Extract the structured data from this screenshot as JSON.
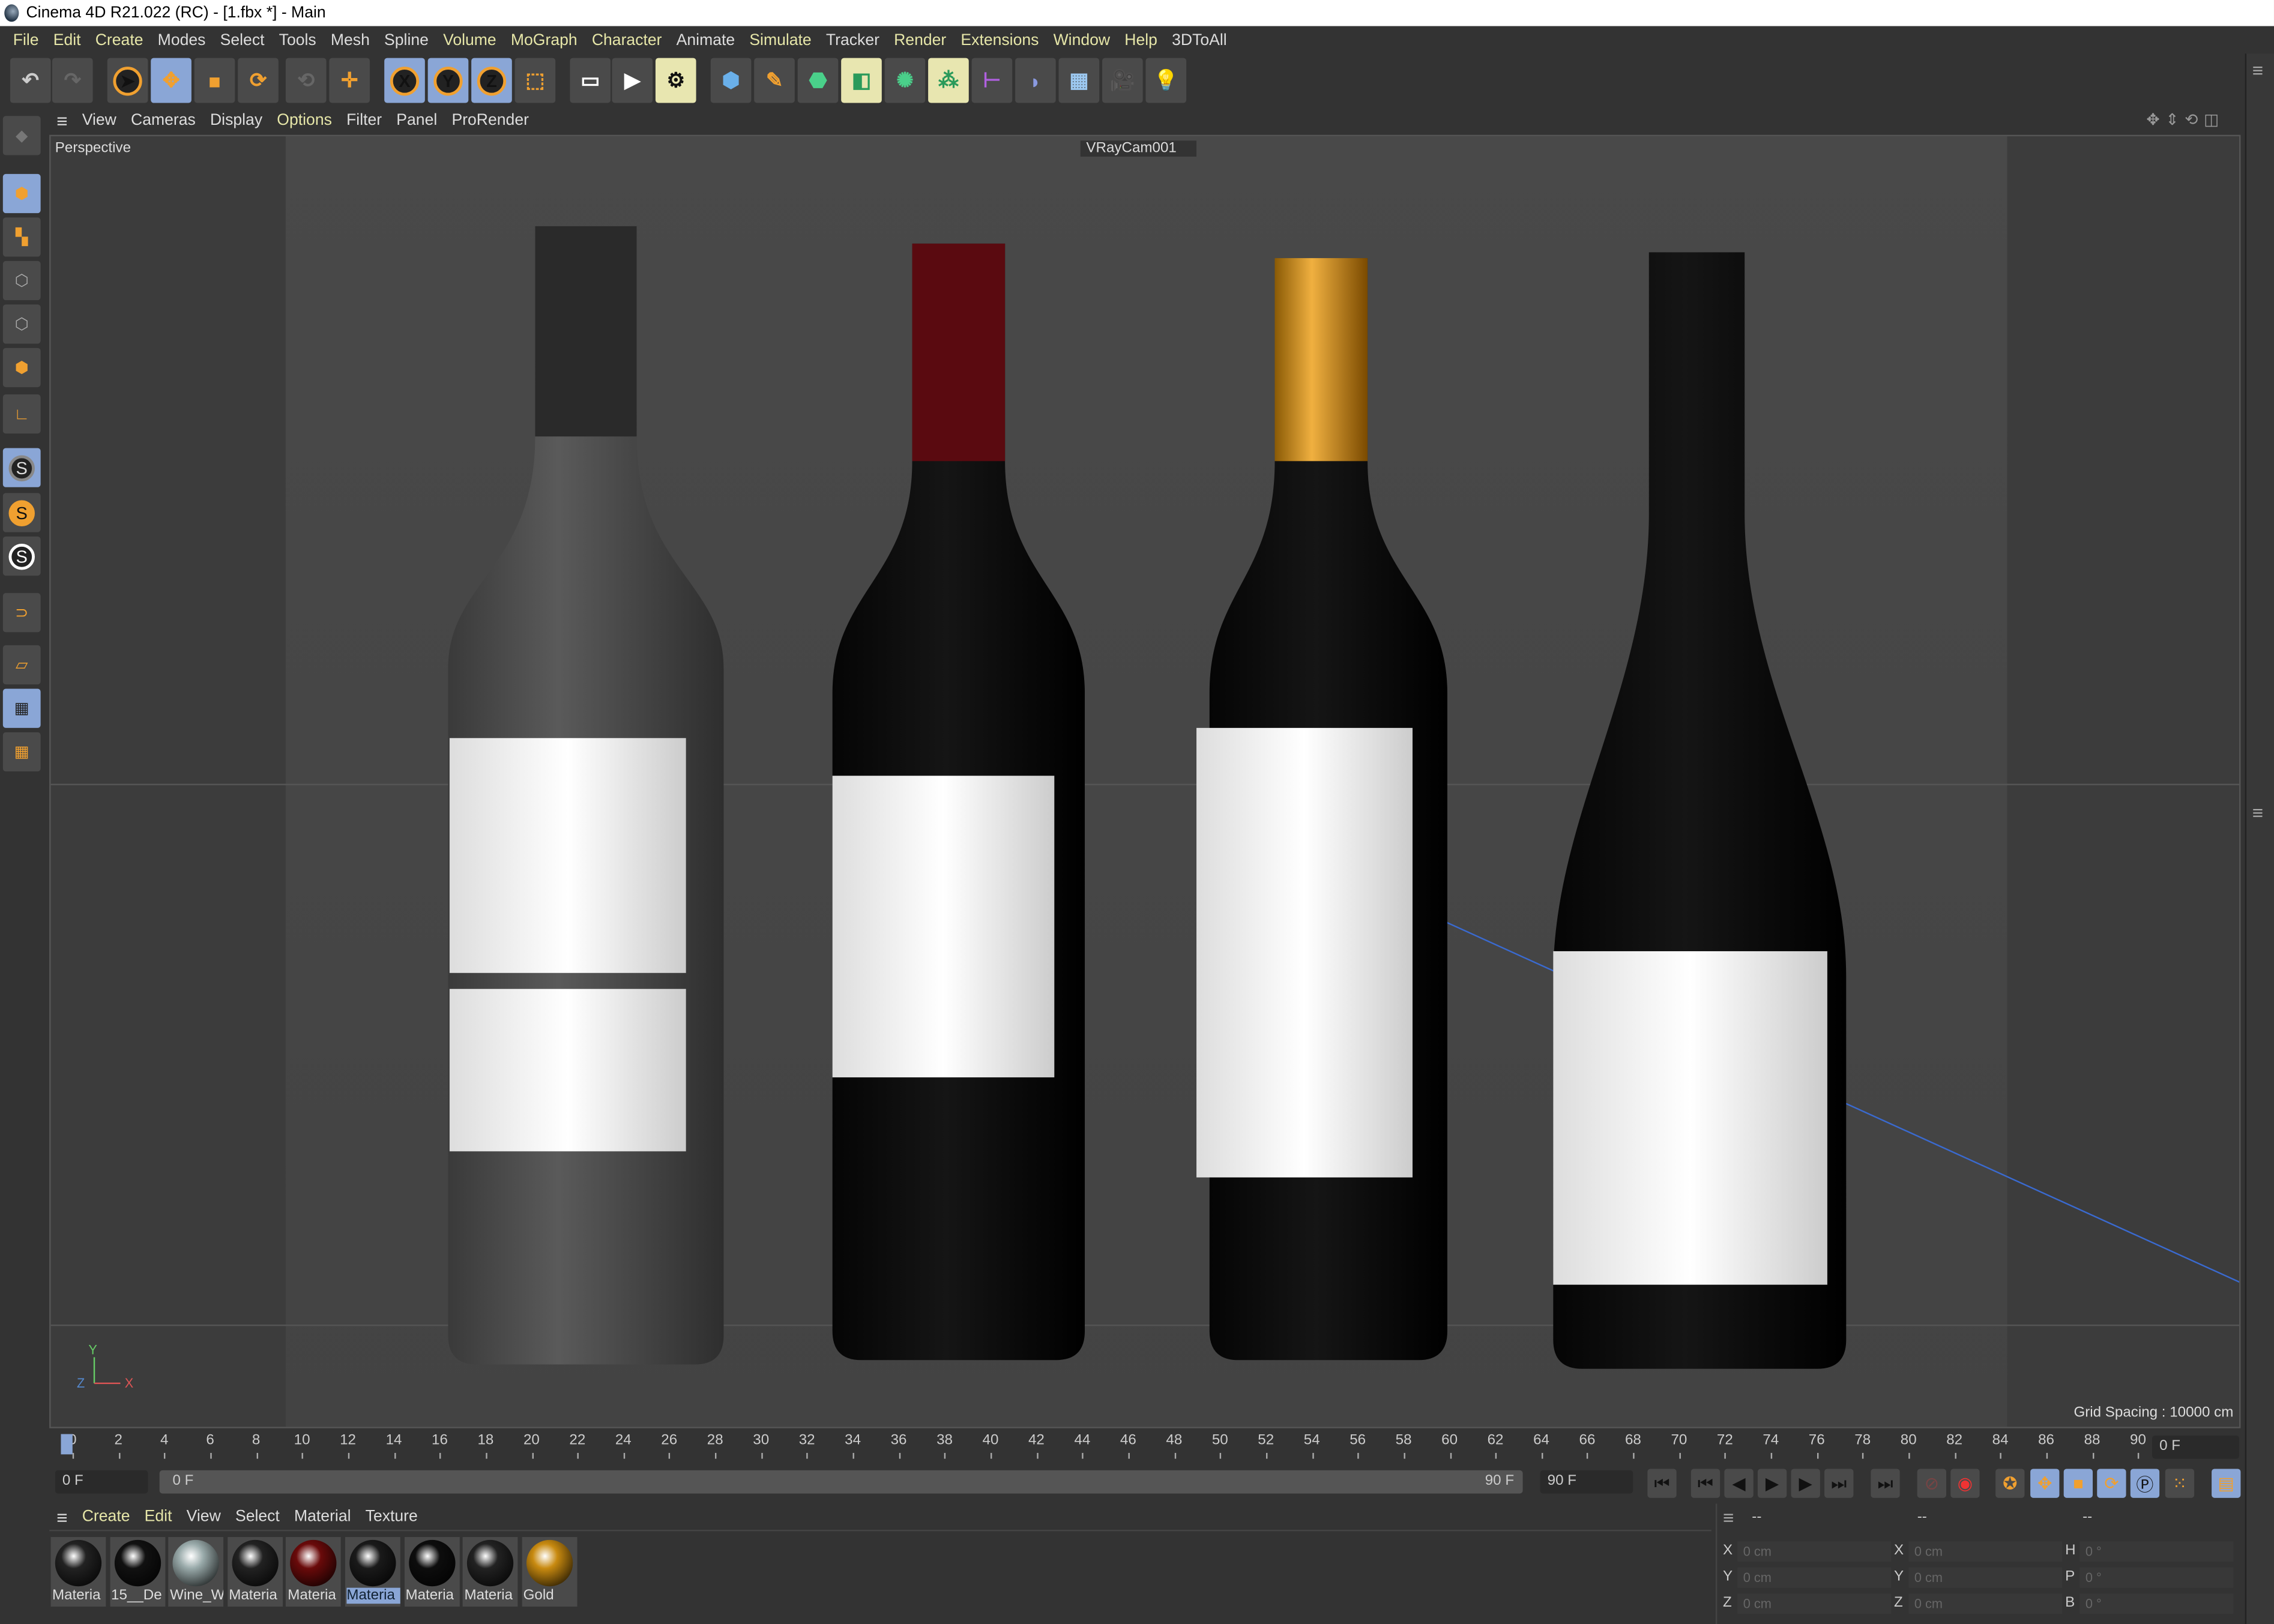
{
  "window": {
    "title": "Cinema 4D R21.022 (RC) - [1.fbx *] - Main"
  },
  "menu": [
    "File",
    "Edit",
    "Create",
    "Modes",
    "Select",
    "Tools",
    "Mesh",
    "Spline",
    "Volume",
    "MoGraph",
    "Character",
    "Animate",
    "Simulate",
    "Tracker",
    "Render",
    "Extensions",
    "Window",
    "Help",
    "3DToAll"
  ],
  "toolbar": {
    "axis_x": "X",
    "axis_y": "Y",
    "axis_z": "Z"
  },
  "viewport": {
    "menu": [
      "View",
      "Cameras",
      "Display",
      "Options",
      "Filter",
      "Panel",
      "ProRender"
    ],
    "name": "Perspective",
    "camera": "VRayCam001",
    "grid_spacing": "Grid Spacing : 10000 cm",
    "axis_labels": {
      "x": "X",
      "y": "Y",
      "z": "Z"
    }
  },
  "timeline": {
    "ticks": [
      "0",
      "2",
      "4",
      "6",
      "8",
      "10",
      "12",
      "14",
      "16",
      "18",
      "20",
      "22",
      "24",
      "26",
      "28",
      "30",
      "32",
      "34",
      "36",
      "38",
      "40",
      "42",
      "44",
      "46",
      "48",
      "50",
      "52",
      "54",
      "56",
      "58",
      "60",
      "62",
      "64",
      "66",
      "68",
      "70",
      "72",
      "74",
      "76",
      "78",
      "80",
      "82",
      "84",
      "86",
      "88",
      "90"
    ],
    "current_frame": "0 F",
    "start_field": "0 F",
    "range_start": "0 F",
    "range_end": "90 F",
    "end_field": "90 F"
  },
  "material_manager": {
    "menu": [
      "Create",
      "Edit",
      "View",
      "Select",
      "Material",
      "Texture"
    ],
    "materials": [
      {
        "name": "Materia",
        "color": "#222"
      },
      {
        "name": "15__De",
        "color": "#111"
      },
      {
        "name": "Wine_W",
        "color": "#9aa"
      },
      {
        "name": "Materia",
        "color": "#222"
      },
      {
        "name": "Materia",
        "color": "#6a0a0a"
      },
      {
        "name": "Materia",
        "color": "#1a1a1a"
      },
      {
        "name": "Materia",
        "color": "#0d0d0d"
      },
      {
        "name": "Materia",
        "color": "#222"
      },
      {
        "name": "Gold",
        "color": "#c88a10"
      }
    ]
  },
  "coordinates": {
    "headers": [
      "--",
      "--",
      "--"
    ],
    "rows": [
      {
        "l1": "X",
        "v1": "0 cm",
        "l2": "X",
        "v2": "0 cm",
        "l3": "H",
        "v3": "0 °"
      },
      {
        "l1": "Y",
        "v1": "0 cm",
        "l2": "Y",
        "v2": "0 cm",
        "l3": "P",
        "v3": "0 °"
      },
      {
        "l1": "Z",
        "v1": "0 cm",
        "l2": "Z",
        "v2": "0 cm",
        "l3": "B",
        "v3": "0 °"
      }
    ]
  }
}
